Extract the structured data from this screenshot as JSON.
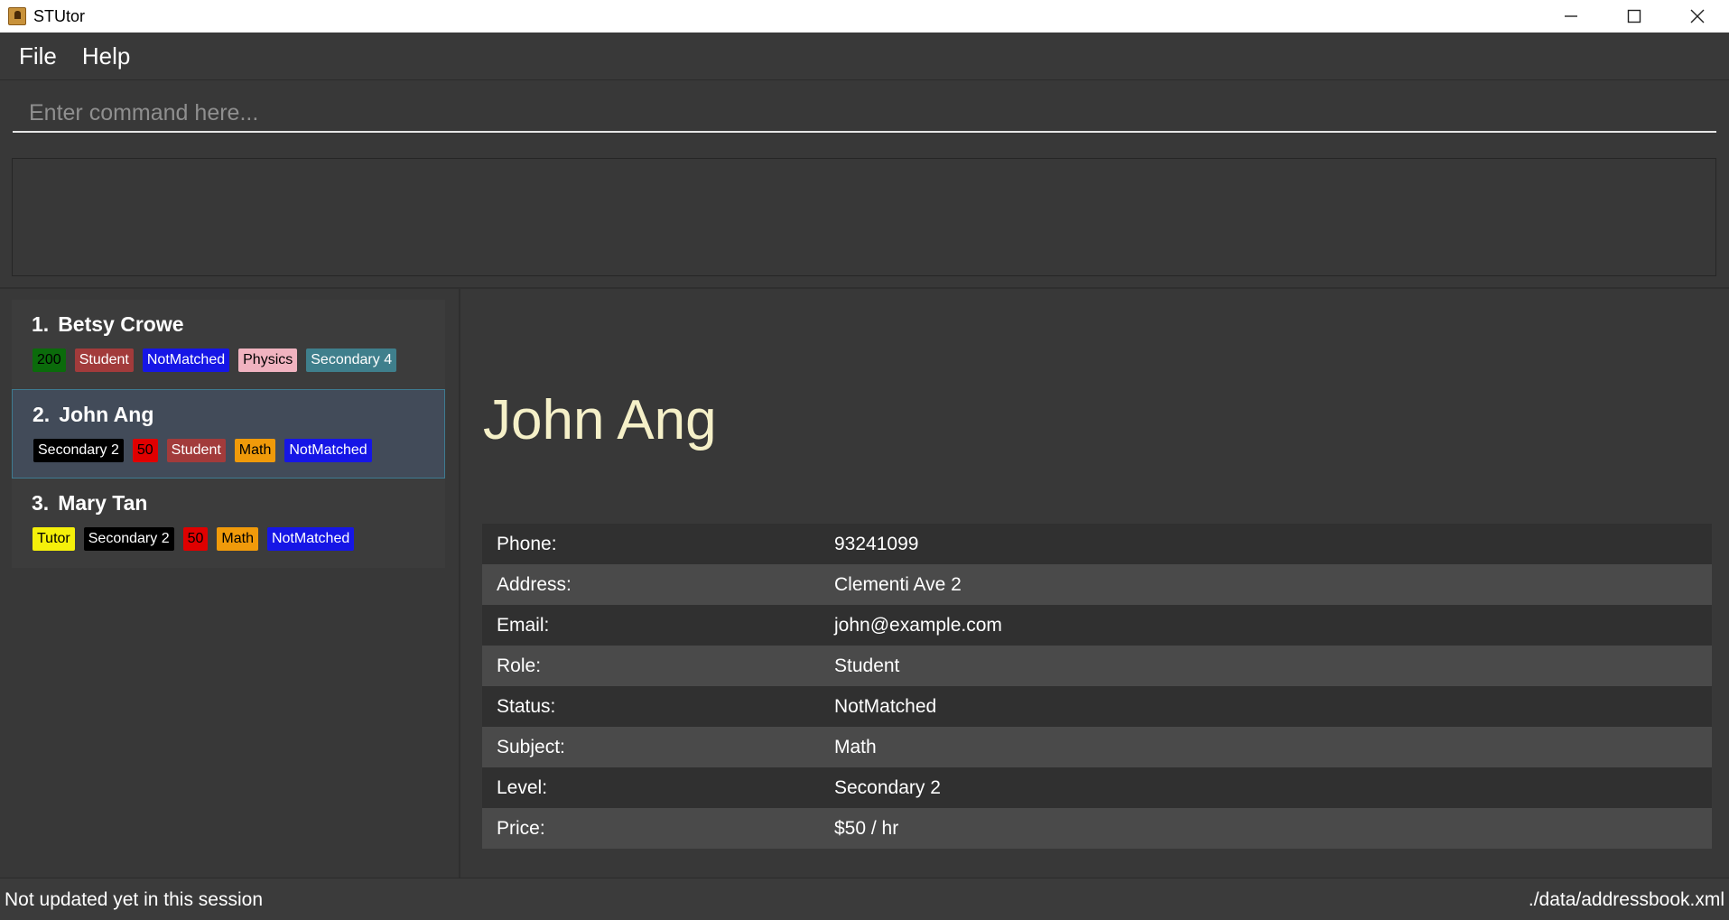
{
  "window": {
    "title": "STUtor"
  },
  "menu": {
    "file": "File",
    "help": "Help"
  },
  "command": {
    "placeholder": "Enter command here..."
  },
  "persons": [
    {
      "index": "1.",
      "name": "Betsy Crowe",
      "selected": false,
      "tags": [
        {
          "text": "200",
          "bg": "#0b6b0b",
          "fg": "#000000"
        },
        {
          "text": "Student",
          "bg": "#a23b3b",
          "fg": "#ffffff"
        },
        {
          "text": "NotMatched",
          "bg": "#1616e6",
          "fg": "#ffffff"
        },
        {
          "text": "Physics",
          "bg": "#f0b3c0",
          "fg": "#000000"
        },
        {
          "text": "Secondary 4",
          "bg": "#3f7f8c",
          "fg": "#ffffff"
        }
      ]
    },
    {
      "index": "2.",
      "name": "John Ang",
      "selected": true,
      "tags": [
        {
          "text": "Secondary 2",
          "bg": "#000000",
          "fg": "#ffffff"
        },
        {
          "text": "50",
          "bg": "#e00000",
          "fg": "#000000"
        },
        {
          "text": "Student",
          "bg": "#a23b3b",
          "fg": "#ffffff"
        },
        {
          "text": "Math",
          "bg": "#f09a0a",
          "fg": "#000000"
        },
        {
          "text": "NotMatched",
          "bg": "#1616e6",
          "fg": "#ffffff"
        }
      ]
    },
    {
      "index": "3.",
      "name": "Mary Tan",
      "selected": false,
      "tags": [
        {
          "text": "Tutor",
          "bg": "#f5f00a",
          "fg": "#000000"
        },
        {
          "text": "Secondary 2",
          "bg": "#000000",
          "fg": "#ffffff"
        },
        {
          "text": "50",
          "bg": "#e00000",
          "fg": "#000000"
        },
        {
          "text": "Math",
          "bg": "#f09a0a",
          "fg": "#000000"
        },
        {
          "text": "NotMatched",
          "bg": "#1616e6",
          "fg": "#ffffff"
        }
      ]
    }
  ],
  "detail": {
    "name": "John Ang",
    "rows": [
      {
        "label": "Phone:",
        "value": "93241099"
      },
      {
        "label": "Address:",
        "value": "Clementi Ave 2"
      },
      {
        "label": "Email:",
        "value": "john@example.com"
      },
      {
        "label": "Role:",
        "value": "Student"
      },
      {
        "label": "Status:",
        "value": "NotMatched"
      },
      {
        "label": "Subject:",
        "value": "Math"
      },
      {
        "label": "Level:",
        "value": "Secondary 2"
      },
      {
        "label": "Price:",
        "value": "$50 / hr"
      }
    ]
  },
  "status": {
    "sync": "Not updated yet in this session",
    "path": "./data/addressbook.xml"
  }
}
